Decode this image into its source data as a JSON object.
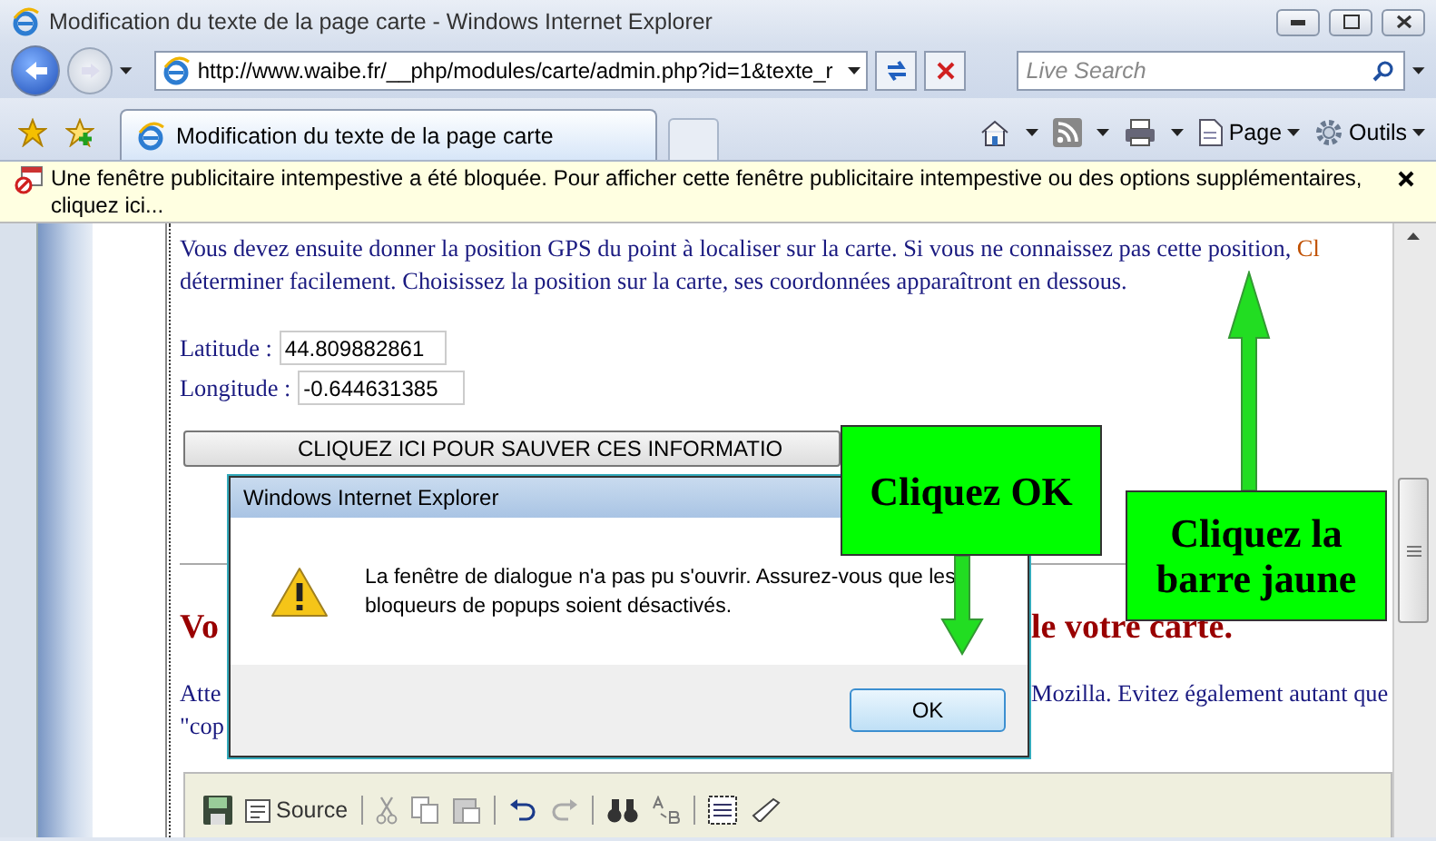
{
  "window": {
    "title": "Modification du texte de la page carte - Windows Internet Explorer"
  },
  "address_bar": {
    "url": "http://www.waibe.fr/__php/modules/carte/admin.php?id=1&texte_r"
  },
  "search": {
    "placeholder": "Live Search"
  },
  "tabs": [
    {
      "label": "Modification du texte de la page carte",
      "selected": true
    }
  ],
  "command_bar": {
    "page": "Page",
    "tools": "Outils"
  },
  "info_bar": {
    "text": "Une fenêtre publicitaire intempestive a été bloquée. Pour afficher cette fenêtre publicitaire intempestive ou des options supplémentaires, cliquez ici..."
  },
  "page": {
    "intro_lines": [
      "Vous devez ensuite donner la position GPS du point à localiser sur la carte. Si vous ne connaissez pas cette position,",
      "déterminer facilement. Choisissez la position sur la carte, ses coordonnées apparaîtront en dessous."
    ],
    "intro_link": "Cl",
    "fields": [
      {
        "label": "Latitude :",
        "value": "44.809882861"
      },
      {
        "label": "Longitude :",
        "value": "-0.644631385"
      }
    ],
    "save_button": "CLIQUEZ ICI POUR SAUVER CES INFORMATIO",
    "heading": {
      "left": "Vo",
      "right": "le votre carte."
    },
    "notice_lines": [
      {
        "left": "Atte",
        "right": "Mozilla. Evitez également autant que"
      },
      {
        "left": "\"cop"
      }
    ],
    "editor_toolbar": {
      "source": "Source"
    }
  },
  "dialog": {
    "title": "Windows Internet Explorer",
    "message": "La fenêtre de dialogue n'a pas pu s'ouvrir. Assurez-vous que les bloqueurs de popups soient désactivés.",
    "button": "OK"
  },
  "callouts": [
    {
      "text": "Cliquez OK"
    },
    {
      "text": "Cliquez la barre jaune"
    }
  ]
}
